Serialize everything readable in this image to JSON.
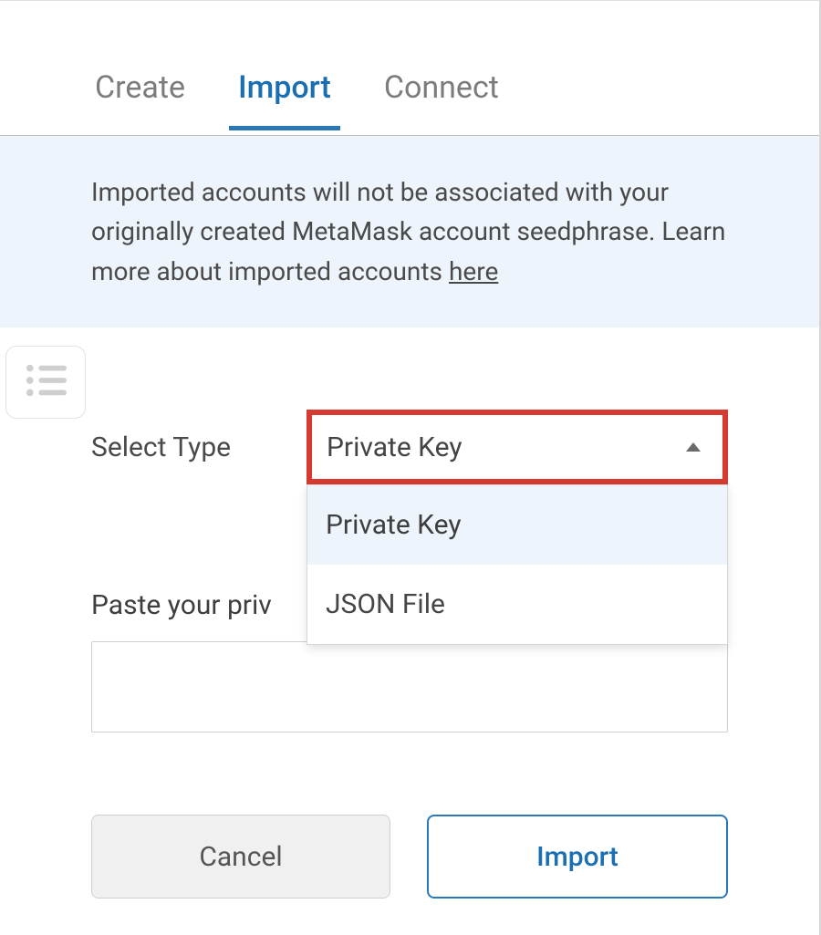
{
  "tabs": {
    "create": "Create",
    "import": "Import",
    "connect": "Connect"
  },
  "info": {
    "text": "Imported accounts will not be associated with your originally created MetaMask account seedphrase. Learn more about imported accounts ",
    "link_label": "here"
  },
  "select": {
    "label": "Select Type",
    "value": "Private Key",
    "options": [
      "Private Key",
      "JSON File"
    ]
  },
  "paste": {
    "label": "Paste your private key string here:",
    "label_visible": "Paste your priv"
  },
  "buttons": {
    "cancel": "Cancel",
    "import": "Import"
  }
}
